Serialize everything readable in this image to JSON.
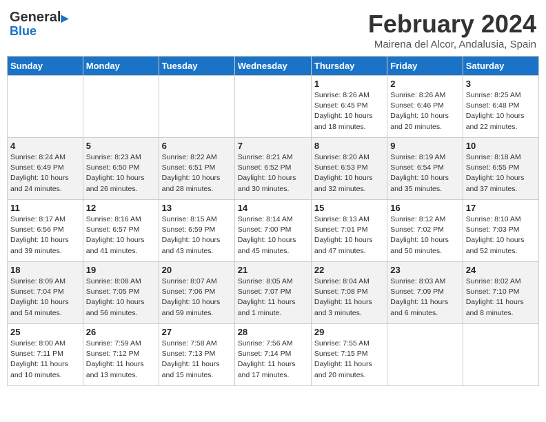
{
  "header": {
    "logo_line1": "General",
    "logo_line2": "Blue",
    "month_title": "February 2024",
    "subtitle": "Mairena del Alcor, Andalusia, Spain"
  },
  "weekdays": [
    "Sunday",
    "Monday",
    "Tuesday",
    "Wednesday",
    "Thursday",
    "Friday",
    "Saturday"
  ],
  "weeks": [
    [
      {
        "num": "",
        "info": ""
      },
      {
        "num": "",
        "info": ""
      },
      {
        "num": "",
        "info": ""
      },
      {
        "num": "",
        "info": ""
      },
      {
        "num": "1",
        "info": "Sunrise: 8:26 AM\nSunset: 6:45 PM\nDaylight: 10 hours\nand 18 minutes."
      },
      {
        "num": "2",
        "info": "Sunrise: 8:26 AM\nSunset: 6:46 PM\nDaylight: 10 hours\nand 20 minutes."
      },
      {
        "num": "3",
        "info": "Sunrise: 8:25 AM\nSunset: 6:48 PM\nDaylight: 10 hours\nand 22 minutes."
      }
    ],
    [
      {
        "num": "4",
        "info": "Sunrise: 8:24 AM\nSunset: 6:49 PM\nDaylight: 10 hours\nand 24 minutes."
      },
      {
        "num": "5",
        "info": "Sunrise: 8:23 AM\nSunset: 6:50 PM\nDaylight: 10 hours\nand 26 minutes."
      },
      {
        "num": "6",
        "info": "Sunrise: 8:22 AM\nSunset: 6:51 PM\nDaylight: 10 hours\nand 28 minutes."
      },
      {
        "num": "7",
        "info": "Sunrise: 8:21 AM\nSunset: 6:52 PM\nDaylight: 10 hours\nand 30 minutes."
      },
      {
        "num": "8",
        "info": "Sunrise: 8:20 AM\nSunset: 6:53 PM\nDaylight: 10 hours\nand 32 minutes."
      },
      {
        "num": "9",
        "info": "Sunrise: 8:19 AM\nSunset: 6:54 PM\nDaylight: 10 hours\nand 35 minutes."
      },
      {
        "num": "10",
        "info": "Sunrise: 8:18 AM\nSunset: 6:55 PM\nDaylight: 10 hours\nand 37 minutes."
      }
    ],
    [
      {
        "num": "11",
        "info": "Sunrise: 8:17 AM\nSunset: 6:56 PM\nDaylight: 10 hours\nand 39 minutes."
      },
      {
        "num": "12",
        "info": "Sunrise: 8:16 AM\nSunset: 6:57 PM\nDaylight: 10 hours\nand 41 minutes."
      },
      {
        "num": "13",
        "info": "Sunrise: 8:15 AM\nSunset: 6:59 PM\nDaylight: 10 hours\nand 43 minutes."
      },
      {
        "num": "14",
        "info": "Sunrise: 8:14 AM\nSunset: 7:00 PM\nDaylight: 10 hours\nand 45 minutes."
      },
      {
        "num": "15",
        "info": "Sunrise: 8:13 AM\nSunset: 7:01 PM\nDaylight: 10 hours\nand 47 minutes."
      },
      {
        "num": "16",
        "info": "Sunrise: 8:12 AM\nSunset: 7:02 PM\nDaylight: 10 hours\nand 50 minutes."
      },
      {
        "num": "17",
        "info": "Sunrise: 8:10 AM\nSunset: 7:03 PM\nDaylight: 10 hours\nand 52 minutes."
      }
    ],
    [
      {
        "num": "18",
        "info": "Sunrise: 8:09 AM\nSunset: 7:04 PM\nDaylight: 10 hours\nand 54 minutes."
      },
      {
        "num": "19",
        "info": "Sunrise: 8:08 AM\nSunset: 7:05 PM\nDaylight: 10 hours\nand 56 minutes."
      },
      {
        "num": "20",
        "info": "Sunrise: 8:07 AM\nSunset: 7:06 PM\nDaylight: 10 hours\nand 59 minutes."
      },
      {
        "num": "21",
        "info": "Sunrise: 8:05 AM\nSunset: 7:07 PM\nDaylight: 11 hours\nand 1 minute."
      },
      {
        "num": "22",
        "info": "Sunrise: 8:04 AM\nSunset: 7:08 PM\nDaylight: 11 hours\nand 3 minutes."
      },
      {
        "num": "23",
        "info": "Sunrise: 8:03 AM\nSunset: 7:09 PM\nDaylight: 11 hours\nand 6 minutes."
      },
      {
        "num": "24",
        "info": "Sunrise: 8:02 AM\nSunset: 7:10 PM\nDaylight: 11 hours\nand 8 minutes."
      }
    ],
    [
      {
        "num": "25",
        "info": "Sunrise: 8:00 AM\nSunset: 7:11 PM\nDaylight: 11 hours\nand 10 minutes."
      },
      {
        "num": "26",
        "info": "Sunrise: 7:59 AM\nSunset: 7:12 PM\nDaylight: 11 hours\nand 13 minutes."
      },
      {
        "num": "27",
        "info": "Sunrise: 7:58 AM\nSunset: 7:13 PM\nDaylight: 11 hours\nand 15 minutes."
      },
      {
        "num": "28",
        "info": "Sunrise: 7:56 AM\nSunset: 7:14 PM\nDaylight: 11 hours\nand 17 minutes."
      },
      {
        "num": "29",
        "info": "Sunrise: 7:55 AM\nSunset: 7:15 PM\nDaylight: 11 hours\nand 20 minutes."
      },
      {
        "num": "",
        "info": ""
      },
      {
        "num": "",
        "info": ""
      }
    ]
  ]
}
